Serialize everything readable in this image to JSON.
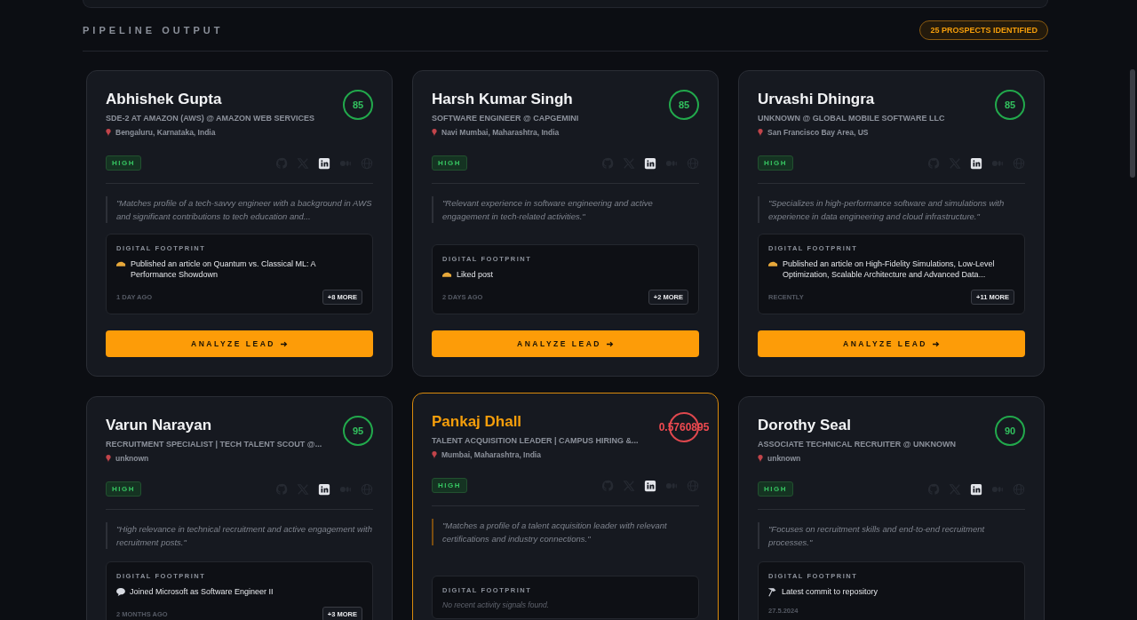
{
  "section": {
    "title": "PIPELINE OUTPUT",
    "badge": "25 PROSPECTS IDENTIFIED"
  },
  "prospects": [
    {
      "name": "Abhishek Gupta",
      "score": "85",
      "score_ok": true,
      "highlighted": false,
      "title": "SDE-2 AT AMAZON (AWS) @ AMAZON WEB SERVICES",
      "location": "Bengaluru, Karnataka, India",
      "priority": "HIGH",
      "socials": [
        {
          "kind": "github",
          "active": false
        },
        {
          "kind": "x",
          "active": false
        },
        {
          "kind": "linkedin",
          "active": true
        },
        {
          "kind": "medium",
          "active": false
        },
        {
          "kind": "web",
          "active": false
        }
      ],
      "summary": "\"Matches profile of a tech-savvy engineer with a background in AWS and significant contributions to tech education and...",
      "footprint": {
        "label": "DIGITAL FOOTPRINT",
        "signal": {
          "kind": "article",
          "text": "Published an article on Quantum vs. Classical ML: A Performance Showdown"
        },
        "time": "1 DAY AGO",
        "more": "+8 MORE"
      },
      "button": "ANALYZE LEAD"
    },
    {
      "name": "Harsh Kumar Singh",
      "score": "85",
      "score_ok": true,
      "highlighted": false,
      "title": "SOFTWARE ENGINEER @ CAPGEMINI",
      "location": "Navi Mumbai, Maharashtra, India",
      "priority": "HIGH",
      "socials": [
        {
          "kind": "github",
          "active": false
        },
        {
          "kind": "x",
          "active": false
        },
        {
          "kind": "linkedin",
          "active": true
        },
        {
          "kind": "medium",
          "active": false
        },
        {
          "kind": "web",
          "active": false
        }
      ],
      "summary": "\"Relevant experience in software engineering and active engagement in tech-related activities.\"",
      "footprint": {
        "label": "DIGITAL FOOTPRINT",
        "signal": {
          "kind": "article",
          "text": "Liked post"
        },
        "time": "2 DAYS AGO",
        "more": "+2 MORE"
      },
      "button": "ANALYZE LEAD"
    },
    {
      "name": "Urvashi Dhingra",
      "score": "85",
      "score_ok": true,
      "highlighted": false,
      "title": "UNKNOWN @ GLOBAL MOBILE SOFTWARE LLC",
      "location": "San Francisco Bay Area, US",
      "priority": "HIGH",
      "socials": [
        {
          "kind": "github",
          "active": false
        },
        {
          "kind": "x",
          "active": false
        },
        {
          "kind": "linkedin",
          "active": true
        },
        {
          "kind": "medium",
          "active": false
        },
        {
          "kind": "web",
          "active": false
        }
      ],
      "summary": "\"Specializes in high-performance software and simulations with experience in data engineering and cloud infrastructure.\"",
      "footprint": {
        "label": "DIGITAL FOOTPRINT",
        "signal": {
          "kind": "article",
          "text": "Published an article on High-Fidelity Simulations, Low-Level Optimization, Scalable Architecture and Advanced Data..."
        },
        "time": "RECENTLY",
        "more": "+11 MORE"
      },
      "button": "ANALYZE LEAD"
    },
    {
      "name": "Varun Narayan",
      "score": "95",
      "score_ok": true,
      "highlighted": false,
      "title": "RECRUITMENT SPECIALIST | TECH TALENT SCOUT @...",
      "location": "unknown",
      "priority": "HIGH",
      "socials": [
        {
          "kind": "github",
          "active": false
        },
        {
          "kind": "x",
          "active": false
        },
        {
          "kind": "linkedin",
          "active": true
        },
        {
          "kind": "medium",
          "active": false
        },
        {
          "kind": "web",
          "active": false
        }
      ],
      "summary": "\"High relevance in technical recruitment and active engagement with recruitment posts.\"",
      "footprint": {
        "label": "DIGITAL FOOTPRINT",
        "signal": {
          "kind": "message",
          "text": "Joined Microsoft as Software Engineer II"
        },
        "time": "2 MONTHS AGO",
        "more": "+3 MORE"
      }
    },
    {
      "name": "Pankaj Dhall",
      "score": "0.5760895",
      "score_ok": false,
      "highlighted": true,
      "title": "TALENT ACQUISITION LEADER | CAMPUS HIRING &...",
      "location": "Mumbai, Maharashtra, India",
      "priority": "HIGH",
      "socials": [
        {
          "kind": "github",
          "active": false
        },
        {
          "kind": "x",
          "active": false
        },
        {
          "kind": "linkedin",
          "active": true
        },
        {
          "kind": "medium",
          "active": false
        },
        {
          "kind": "web",
          "active": false
        }
      ],
      "summary": "\"Matches a profile of a talent acquisition leader with relevant certifications and industry connections.\"",
      "footprint": {
        "label": "DIGITAL FOOTPRINT",
        "empty": "No recent activity signals found."
      }
    },
    {
      "name": "Dorothy Seal",
      "score": "90",
      "score_ok": true,
      "highlighted": false,
      "title": "ASSOCIATE TECHNICAL RECRUITER @ UNKNOWN",
      "location": "unknown",
      "priority": "HIGH",
      "socials": [
        {
          "kind": "github",
          "active": false
        },
        {
          "kind": "x",
          "active": false
        },
        {
          "kind": "linkedin",
          "active": true
        },
        {
          "kind": "medium",
          "active": false
        },
        {
          "kind": "web",
          "active": false
        }
      ],
      "summary": "\"Focuses on recruitment skills and end-to-end recruitment processes.\"",
      "footprint": {
        "label": "DIGITAL FOOTPRINT",
        "signal": {
          "kind": "commit",
          "text": "Latest commit to repository"
        },
        "time": "27.5.2024"
      }
    }
  ]
}
